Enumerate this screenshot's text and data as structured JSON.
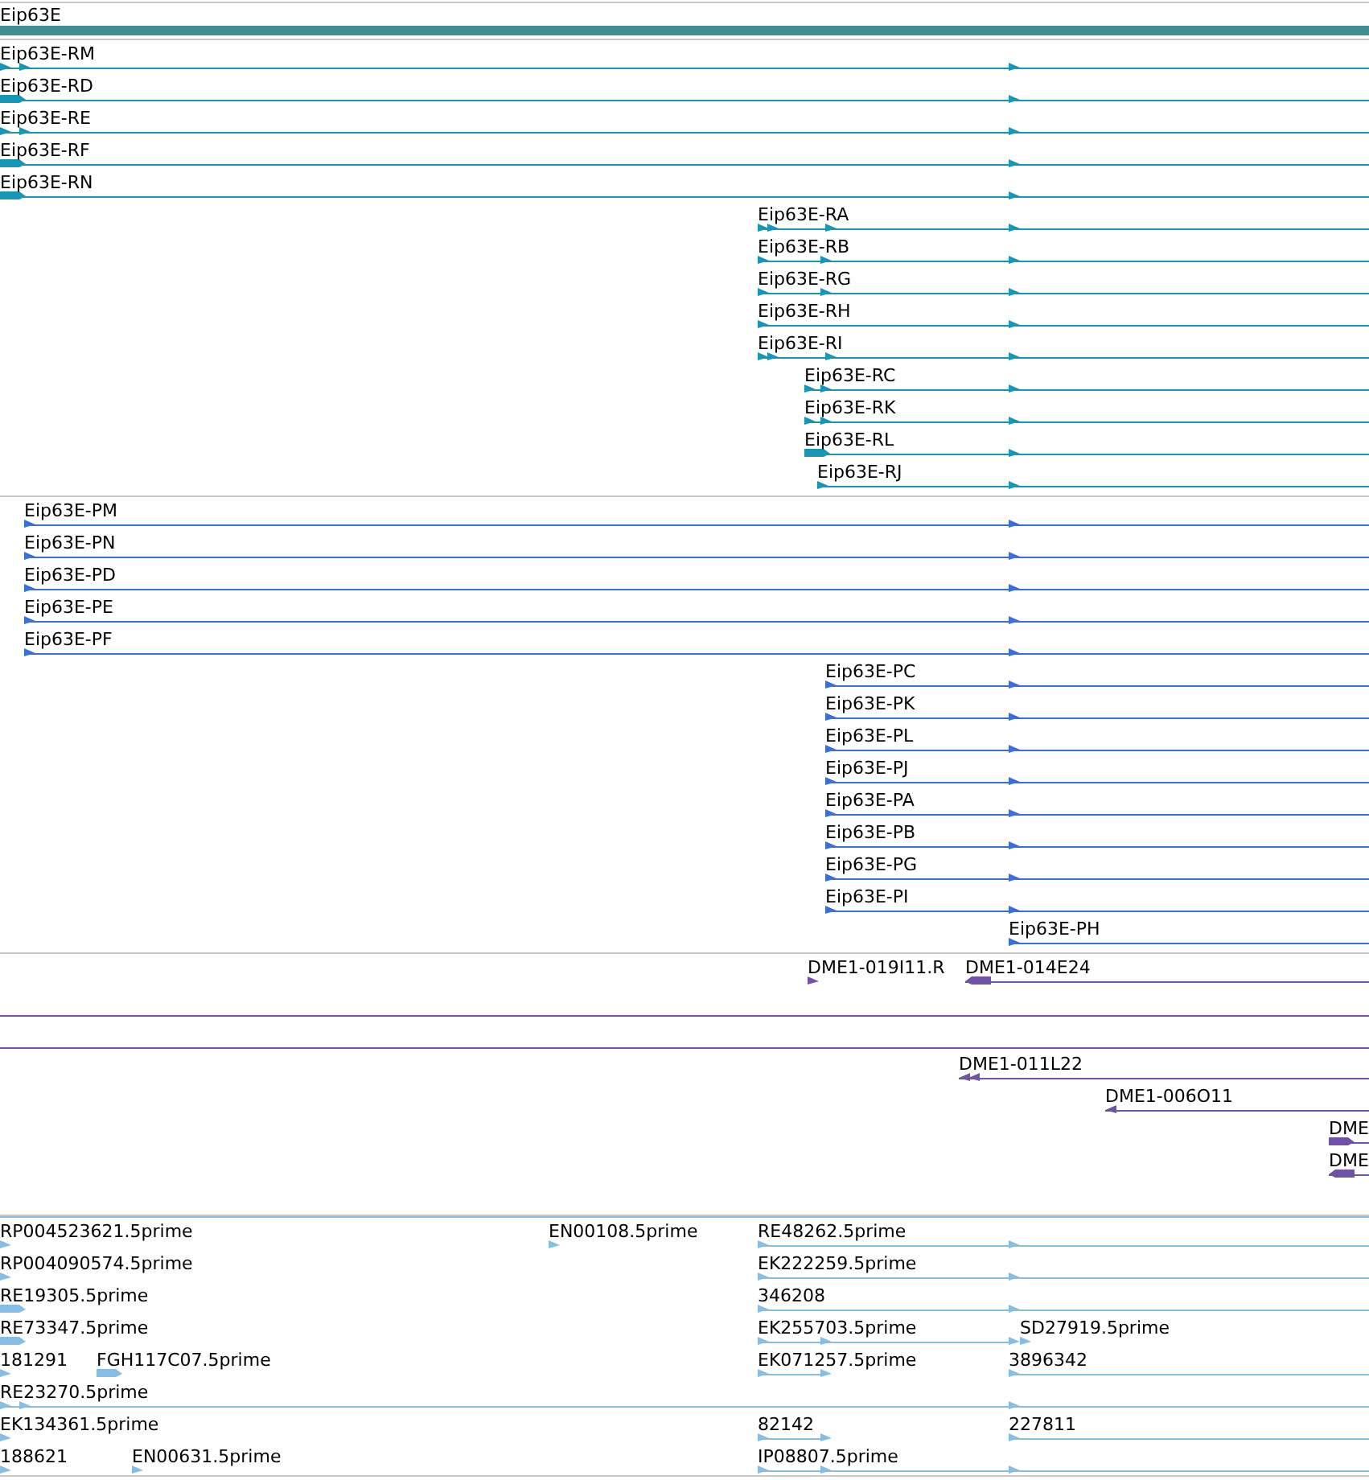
{
  "tracks": [
    {
      "kind": "gene",
      "color": "#3f8f92",
      "label": "Eip63E"
    },
    {
      "kind": "features",
      "color": "#1996b5",
      "features": [
        {
          "label": "Eip63E-RM",
          "reverse": false
        },
        {
          "label": "Eip63E-RD",
          "reverse": false
        },
        {
          "label": "Eip63E-RE",
          "reverse": false
        },
        {
          "label": "Eip63E-RF",
          "reverse": false
        },
        {
          "label": "Eip63E-RN",
          "reverse": false
        },
        {
          "label": "Eip63E-RA",
          "reverse": false
        },
        {
          "label": "Eip63E-RB",
          "reverse": false
        },
        {
          "label": "Eip63E-RG",
          "reverse": false
        },
        {
          "label": "Eip63E-RH",
          "reverse": false
        },
        {
          "label": "Eip63E-RI",
          "reverse": false
        },
        {
          "label": "Eip63E-RC",
          "reverse": false
        },
        {
          "label": "Eip63E-RK",
          "reverse": false
        },
        {
          "label": "Eip63E-RL",
          "reverse": false
        },
        {
          "label": "Eip63E-RJ",
          "reverse": false
        }
      ]
    },
    {
      "kind": "features",
      "color": "#3a70d2",
      "features": [
        {
          "label": "Eip63E-PM",
          "reverse": false
        },
        {
          "label": "Eip63E-PN",
          "reverse": false
        },
        {
          "label": "Eip63E-PD",
          "reverse": false
        },
        {
          "label": "Eip63E-PE",
          "reverse": false
        },
        {
          "label": "Eip63E-PF",
          "reverse": false
        },
        {
          "label": "Eip63E-PC",
          "reverse": false
        },
        {
          "label": "Eip63E-PK",
          "reverse": false
        },
        {
          "label": "Eip63E-PL",
          "reverse": false
        },
        {
          "label": "Eip63E-PJ",
          "reverse": false
        },
        {
          "label": "Eip63E-PA",
          "reverse": false
        },
        {
          "label": "Eip63E-PB",
          "reverse": false
        },
        {
          "label": "Eip63E-PG",
          "reverse": false
        },
        {
          "label": "Eip63E-PI",
          "reverse": false
        },
        {
          "label": "Eip63E-PH",
          "reverse": false
        }
      ]
    },
    {
      "kind": "features",
      "color": "#7052a6",
      "features": [
        {
          "label": "DME1-019I11.R",
          "reverse": false
        },
        {
          "label": "DME1-014E24",
          "reverse": true
        },
        {
          "label": "DME1-011L22",
          "reverse": true
        },
        {
          "label": "DME1-006O11",
          "reverse": true
        },
        {
          "label": "DME",
          "reverse": false
        },
        {
          "label": "DME",
          "reverse": true
        }
      ]
    },
    {
      "kind": "features",
      "color": "#88bde3",
      "features": [
        {
          "label": "RP004523621.5prime",
          "reverse": false
        },
        {
          "label": "EN00108.5prime",
          "reverse": false
        },
        {
          "label": "RE48262.5prime",
          "reverse": false
        },
        {
          "label": "RP004090574.5prime",
          "reverse": false
        },
        {
          "label": "EK222259.5prime",
          "reverse": false
        },
        {
          "label": "RE19305.5prime",
          "reverse": false
        },
        {
          "label": "346208",
          "reverse": false
        },
        {
          "label": "RE73347.5prime",
          "reverse": false
        },
        {
          "label": "EK255703.5prime",
          "reverse": false
        },
        {
          "label": "SD27919.5prime",
          "reverse": false
        },
        {
          "label": "181291",
          "reverse": false
        },
        {
          "label": "FGH117C07.5prime",
          "reverse": false
        },
        {
          "label": "EK071257.5prime",
          "reverse": false
        },
        {
          "label": "3896342",
          "reverse": false
        },
        {
          "label": "RE23270.5prime",
          "reverse": false
        },
        {
          "label": "EK134361.5prime",
          "reverse": false
        },
        {
          "label": "82142",
          "reverse": false
        },
        {
          "label": "227811",
          "reverse": false
        },
        {
          "label": "188621",
          "reverse": false
        },
        {
          "label": "EN00631.5prime",
          "reverse": false
        },
        {
          "label": "IP08807.5prime",
          "reverse": false
        }
      ]
    }
  ]
}
